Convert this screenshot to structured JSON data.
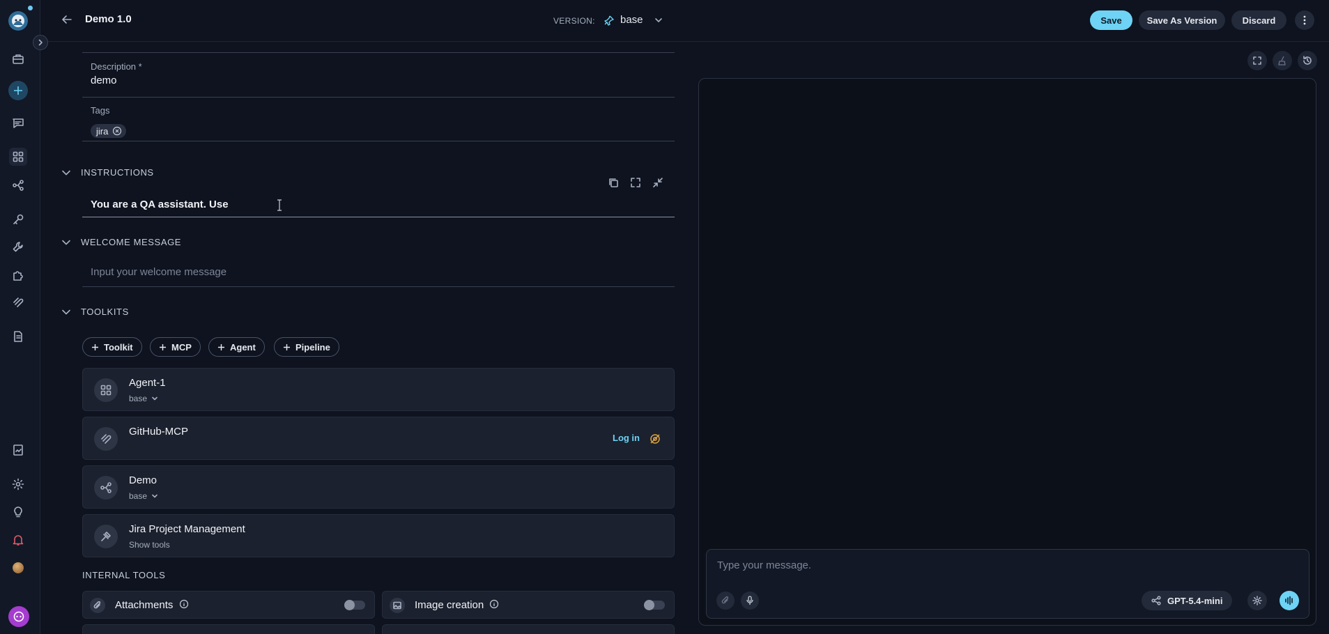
{
  "header": {
    "title": "Demo 1.0",
    "version_label": "VERSION:",
    "version_value": "base",
    "save_label": "Save",
    "save_as_version_label": "Save As Version",
    "discard_label": "Discard"
  },
  "form": {
    "description": {
      "label": "Description *",
      "value": "demo"
    },
    "tags": {
      "label": "Tags",
      "items": [
        "jira"
      ]
    },
    "instructions": {
      "title": "INSTRUCTIONS",
      "value": "You are a QA assistant. Use"
    },
    "welcome": {
      "title": "WELCOME MESSAGE",
      "placeholder": "Input your welcome message"
    },
    "toolkits": {
      "title": "TOOLKITS",
      "add_buttons": [
        "Toolkit",
        "MCP",
        "Agent",
        "Pipeline"
      ],
      "items": [
        {
          "name": "Agent-1",
          "sub": "base",
          "icon": "grid-icon"
        },
        {
          "name": "GitHub-MCP",
          "action": "Log in",
          "icon": "mcp-icon"
        },
        {
          "name": "Demo",
          "sub": "base",
          "icon": "pipeline-icon"
        },
        {
          "name": "Jira Project Management",
          "sub": "Show tools",
          "icon": "jira-icon"
        }
      ]
    },
    "internal_tools": {
      "title": "INTERNAL TOOLS",
      "items": [
        {
          "label": "Attachments",
          "enabled": false,
          "icon": "paperclip-icon"
        },
        {
          "label": "Image creation",
          "enabled": false,
          "icon": "image-icon"
        }
      ]
    }
  },
  "chat": {
    "placeholder": "Type your message.",
    "model": "GPT-5.4-mini"
  },
  "colors": {
    "accent": "#6ed3f4",
    "background": "#0e131f",
    "brand": "#a53ccf"
  }
}
